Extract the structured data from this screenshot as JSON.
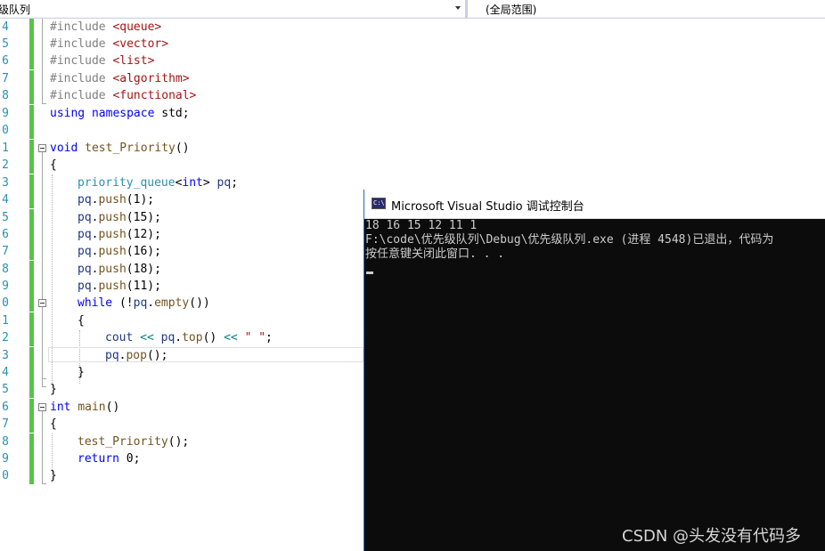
{
  "navbar": {
    "left_text": "级队列",
    "right_text": "(全局范围)"
  },
  "editor": {
    "line_numbers": [
      "4",
      "5",
      "6",
      "7",
      "8",
      "9",
      "0",
      "1",
      "2",
      "3",
      "4",
      "5",
      "6",
      "7",
      "8",
      "9",
      "0",
      "1",
      "2",
      "3",
      "4",
      "5",
      "6",
      "7",
      "8",
      "9",
      "0"
    ],
    "code": {
      "l1_pp": "#include ",
      "l1_str": "<queue>",
      "l2_pp": "#include ",
      "l2_str": "<vector>",
      "l3_pp": "#include ",
      "l3_str": "<list>",
      "l4_pp": "#include ",
      "l4_str": "<algorithm>",
      "l5_pp": "#include ",
      "l5_str": "<functional>",
      "l6_kw1": "using",
      "l6_kw2": "namespace",
      "l6_rest": " std;",
      "l8_kw": "void",
      "l8_fn": "test_Priority",
      "l8_rest": "()",
      "brace_open": "{",
      "brace_close": "}",
      "l10_ty": "priority_queue",
      "l10_op1": "<",
      "l10_kw": "int",
      "l10_op2": ">",
      "l10_var": "pq",
      "l10_rest": ";",
      "push_obj": "pq",
      "push_dot": ".",
      "push_fn": "push",
      "push_args": [
        "(1);",
        "(15);",
        "(12);",
        "(16);",
        "(18);",
        "(11);"
      ],
      "l17_kw": "while",
      "l17_p1": " (!",
      "l17_var": "pq",
      "l17_dot": ".",
      "l17_fn": "empty",
      "l17_p2": "())",
      "l19_var": "cout",
      "l19_op1": "<<",
      "l19_obj": "pq",
      "l19_dot": ".",
      "l19_fn": "top",
      "l19_paren": "()",
      "l19_op2": "<<",
      "l19_str": "\" \"",
      "l19_end": ";",
      "l20_obj": "pq",
      "l20_dot": ".",
      "l20_fn": "pop",
      "l20_end": "();",
      "l23_kw": "int",
      "l23_fn": "main",
      "l23_rest": "()",
      "l25_fn": "test_Priority",
      "l25_rest": "();",
      "l26_kw": "return",
      "l26_rest": " 0;"
    }
  },
  "console": {
    "title": "Microsoft Visual Studio 调试控制台",
    "icon_text": "C:\\",
    "lines": [
      "18 16 15 12 11 1",
      "F:\\code\\优先级队列\\Debug\\优先级队列.exe (进程 4548)已退出，代码为",
      "按任意键关闭此窗口. . ."
    ]
  },
  "watermark": "CSDN @头发没有代码多",
  "colors": {
    "keyword": "#0000ff",
    "preprocessor": "#808080",
    "string": "#a31515",
    "type": "#2b91af",
    "line_number": "#2b91af",
    "change_bar": "#57c348",
    "console_bg": "#0c0c0c",
    "console_text": "#cccccc"
  }
}
